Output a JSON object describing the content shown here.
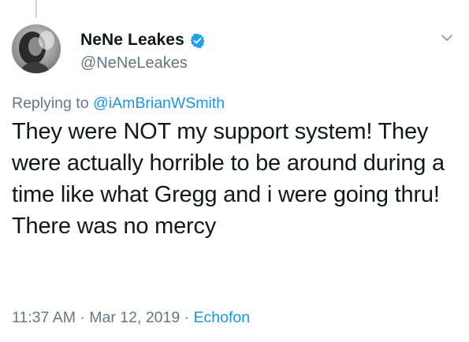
{
  "author": {
    "display_name": "NeNe Leakes",
    "handle": "@NeNeLeakes",
    "verified": true
  },
  "reply": {
    "prefix": "Replying to",
    "mention": "@iAmBrianWSmith"
  },
  "tweet": {
    "text": "They were NOT my support system! They were actually horrible to be around during a time like what Gregg and i were going thru! There was no mercy"
  },
  "meta": {
    "time": "11:37 AM",
    "separator": "·",
    "date": "Mar 12, 2019",
    "source": "Echofon"
  },
  "icons": {
    "verified": "verified-badge-icon",
    "menu": "chevron-down-icon"
  },
  "colors": {
    "text": "#14171a",
    "secondary": "#657786",
    "link": "#1b95e0",
    "verified": "#1da1f2"
  }
}
